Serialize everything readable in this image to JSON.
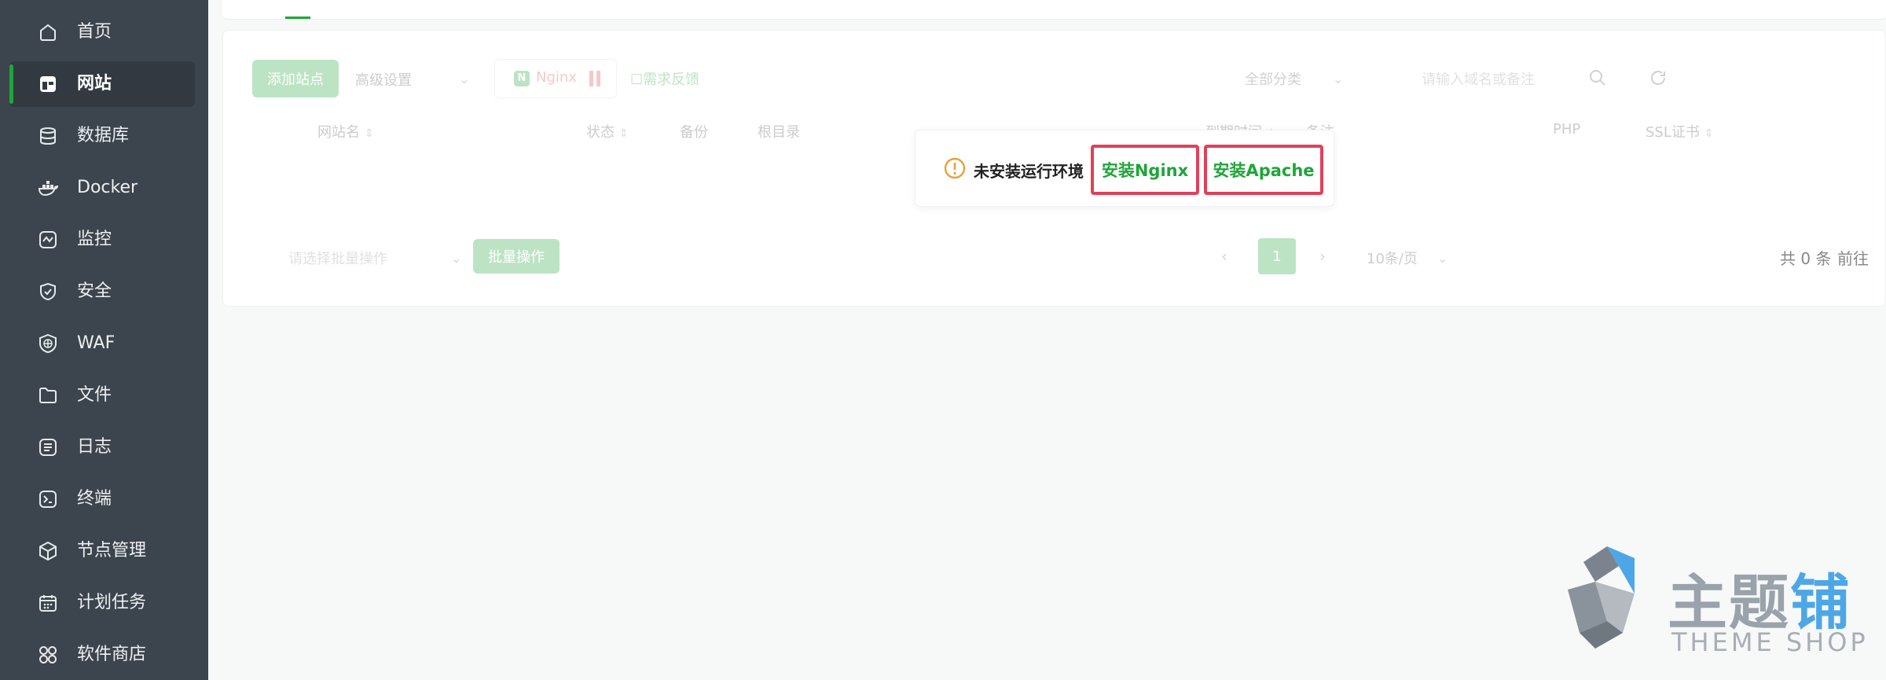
{
  "sidebar": {
    "items": [
      {
        "label": "首页",
        "icon": "home-icon"
      },
      {
        "label": "网站",
        "icon": "website-icon",
        "active": true
      },
      {
        "label": "数据库",
        "icon": "database-icon"
      },
      {
        "label": "Docker",
        "icon": "docker-icon"
      },
      {
        "label": "监控",
        "icon": "monitor-icon"
      },
      {
        "label": "安全",
        "icon": "shield-icon"
      },
      {
        "label": "WAF",
        "icon": "waf-icon"
      },
      {
        "label": "文件",
        "icon": "folder-icon"
      },
      {
        "label": "日志",
        "icon": "log-icon"
      },
      {
        "label": "终端",
        "icon": "terminal-icon"
      },
      {
        "label": "节点管理",
        "icon": "node-icon"
      },
      {
        "label": "计划任务",
        "icon": "calendar-icon"
      },
      {
        "label": "软件商店",
        "icon": "store-icon"
      }
    ]
  },
  "toolbar": {
    "add_site": "添加站点",
    "advanced": "高级设置",
    "nginx_label": "Nginx",
    "feedback": "需求反馈",
    "category": "全部分类",
    "search_placeholder": "请输入域名或备注"
  },
  "table": {
    "headers": [
      "网站名",
      "状态",
      "备份",
      "根目录",
      "到期时间",
      "备注",
      "PHP",
      "SSL证书"
    ]
  },
  "footer": {
    "batch_placeholder": "请选择批量操作",
    "batch_button": "批量操作",
    "current_page": "1",
    "page_size": "10条/页",
    "total": "共 0 条",
    "goto": "前往"
  },
  "popup": {
    "message": "未安装运行环境",
    "install_nginx": "安装Nginx",
    "install_apache": "安装Apache"
  },
  "watermark": {
    "cn_part1": "主题",
    "cn_part2": "铺",
    "en": "THEME SHOP"
  },
  "colors": {
    "sidebar_bg": "#3c444d",
    "accent_green": "#20a53a",
    "highlight_red": "#e0405a",
    "warning_orange": "#e6a23c"
  }
}
